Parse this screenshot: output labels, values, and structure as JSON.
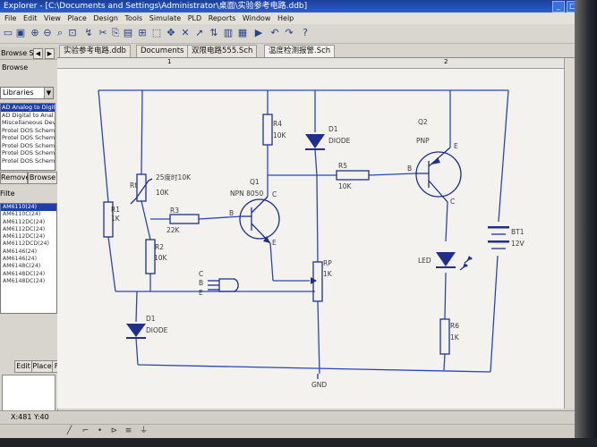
{
  "window": {
    "title": "Explorer - [C:\\Documents and Settings\\Administrator\\桌面\\实验参考电路.ddb]"
  },
  "menu": [
    "File",
    "Edit",
    "View",
    "Place",
    "Design",
    "Tools",
    "Simulate",
    "PLD",
    "Reports",
    "Window",
    "Help"
  ],
  "left_panel": {
    "header": "Browse Sch",
    "browse_label": "Browse",
    "library_select": "Libraries",
    "libraries": [
      "AD Analog to Digit",
      "AD Digital to Anal",
      "Miscellaneous Devi",
      "Protel DOS Schema",
      "Protel DOS Schema",
      "Protel DOS Schema",
      "Protel DOS Schema",
      "Protel DOS Schema"
    ],
    "remove_button": "Remove",
    "browse_button": "Browse",
    "filter_label": "Filte",
    "components": [
      "AM6110(24)",
      "AM6110C(24)",
      "AM6112DC(24)",
      "AM6112DC(24)",
      "AM6112DC(24)",
      "AM6112DCD(24)",
      "AM6146(24)",
      "AM6146(24)",
      "AM6148C(24)",
      "AM6148DC(24)",
      "AM6148DC(24)"
    ],
    "edit_button": "Edit",
    "place_button": "Place",
    "find_button": "Find"
  },
  "tabs": [
    {
      "label": "实验参考电路.ddb",
      "active": false
    },
    {
      "label": "Documents",
      "active": false
    },
    {
      "label": "双限电路555.Sch",
      "active": false
    },
    {
      "label": "温度检测报警.Sch",
      "active": true
    }
  ],
  "ruler": {
    "marks": [
      "1",
      "2"
    ]
  },
  "status": {
    "coords": "X:481 Y:40"
  },
  "schematic": {
    "r1_name": "R1",
    "r1_value": "1K",
    "rt_name": "Rt",
    "rt_value": "25度时10K",
    "rt_value2": "10K",
    "r2_name": "R2",
    "r2_value": "10K",
    "r3_name": "R3",
    "r3_value": "22K",
    "r4_name": "R4",
    "r4_value": "10K",
    "r5_name": "R5",
    "r5_value": "10K",
    "r6_name": "R6",
    "r6_value": "1K",
    "rp_name": "RP",
    "rp_value": "1K",
    "d1_top_name": "D1",
    "d1_top_value": "DIODE",
    "d1_bottom_name": "D1",
    "d1_bottom_value": "DIODE",
    "q1_name": "Q1",
    "q1_type": "NPN 8050",
    "q2_name": "Q2",
    "q2_type": "PNP",
    "bt1_name": "BT1",
    "bt1_value": "12V",
    "led_name": "LED",
    "pin_b": "B",
    "pin_c": "C",
    "pin_e": "E",
    "pkg_c": "C",
    "pkg_b": "B",
    "pkg_e": "E",
    "gnd_label": "GND"
  },
  "colors": {
    "wire": "#2a45b8",
    "component": "#1e2f8e",
    "text": "#3b3b3b",
    "accent": "#1c3fa8"
  }
}
